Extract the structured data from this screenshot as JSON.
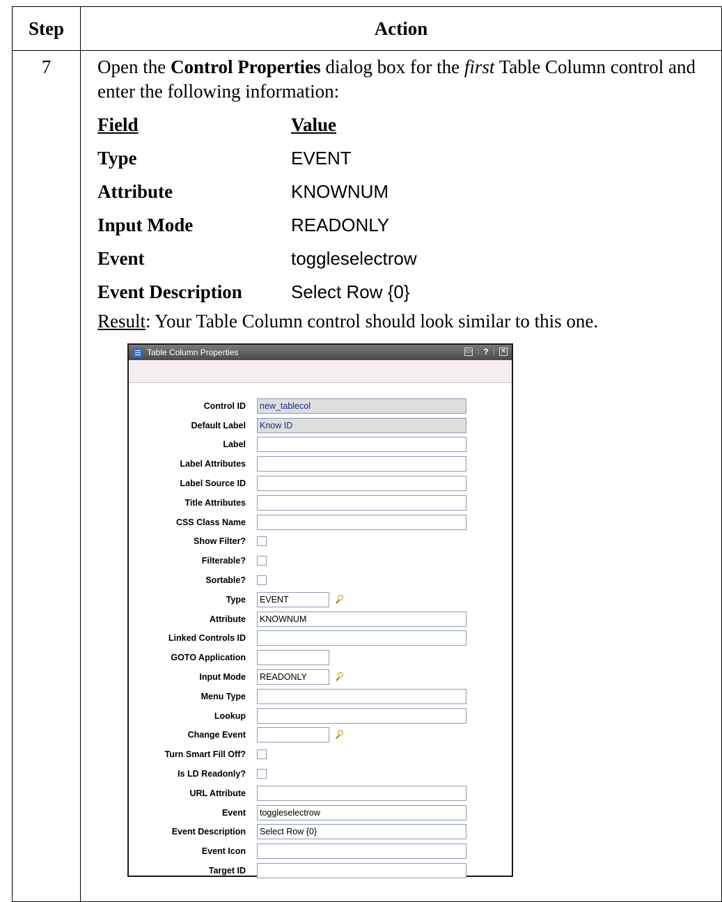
{
  "table": {
    "header_step": "Step",
    "header_action": "Action",
    "step_number": "7",
    "intro": {
      "part1": "Open the ",
      "bold1": "Control Properties",
      "part2": " dialog box for the ",
      "italic1": "first",
      "part3": " Table Column control and enter the following information:"
    },
    "field_header": "Field",
    "value_header": "Value",
    "fields": [
      {
        "name": "Type",
        "value": "EVENT"
      },
      {
        "name": "Attribute",
        "value": "KNOWNUM"
      },
      {
        "name": "Input Mode",
        "value": "READONLY"
      },
      {
        "name": "Event",
        "value": "toggleselectrow"
      },
      {
        "name": "Event Description",
        "value": "Select Row {0}"
      }
    ],
    "result_label": "Result",
    "result_text": ": Your Table Column control should look similar to this one."
  },
  "dialog": {
    "title": "Table Column Properties",
    "title_icon": "dialog-icon",
    "controls": {
      "minimize_icon": "minimize-icon",
      "help_label": "?",
      "close_icon": "close-icon"
    },
    "rows": [
      {
        "label": "Control ID",
        "kind": "text",
        "width": "full",
        "readonly": true,
        "value": "new_tablecol"
      },
      {
        "label": "Default Label",
        "kind": "text",
        "width": "full",
        "readonly": true,
        "value": "Know ID"
      },
      {
        "label": "Label",
        "kind": "text",
        "width": "full",
        "value": ""
      },
      {
        "label": "Label Attributes",
        "kind": "text",
        "width": "full",
        "value": ""
      },
      {
        "label": "Label Source ID",
        "kind": "text",
        "width": "full",
        "value": ""
      },
      {
        "label": "Title Attributes",
        "kind": "text",
        "width": "full",
        "value": ""
      },
      {
        "label": "CSS Class Name",
        "kind": "text",
        "width": "full",
        "value": ""
      },
      {
        "label": "Show Filter?",
        "kind": "check"
      },
      {
        "label": "Filterable?",
        "kind": "check"
      },
      {
        "label": "Sortable?",
        "kind": "check"
      },
      {
        "label": "Type",
        "kind": "text",
        "width": "short",
        "lookup": true,
        "value": "EVENT"
      },
      {
        "label": "Attribute",
        "kind": "text",
        "width": "full",
        "value": "KNOWNUM"
      },
      {
        "label": "Linked Controls ID",
        "kind": "text",
        "width": "full",
        "value": ""
      },
      {
        "label": "GOTO Application",
        "kind": "text",
        "width": "short",
        "value": ""
      },
      {
        "label": "Input Mode",
        "kind": "text",
        "width": "short",
        "lookup": true,
        "value": "READONLY"
      },
      {
        "label": "Menu Type",
        "kind": "text",
        "width": "full",
        "value": ""
      },
      {
        "label": "Lookup",
        "kind": "text",
        "width": "full",
        "value": ""
      },
      {
        "label": "Change Event",
        "kind": "text",
        "width": "short",
        "lookup": true,
        "value": ""
      },
      {
        "label": "Turn Smart Fill Off?",
        "kind": "check"
      },
      {
        "label": "Is LD Readonly?",
        "kind": "check"
      },
      {
        "label": "URL Attribute",
        "kind": "text",
        "width": "full",
        "value": ""
      },
      {
        "label": "Event",
        "kind": "text",
        "width": "full",
        "value": "toggleselectrow"
      },
      {
        "label": "Event Description",
        "kind": "text",
        "width": "full",
        "value": "Select Row {0}"
      },
      {
        "label": "Event Icon",
        "kind": "text",
        "width": "full",
        "value": ""
      },
      {
        "label": "Target ID",
        "kind": "text",
        "width": "full",
        "value": ""
      }
    ]
  }
}
